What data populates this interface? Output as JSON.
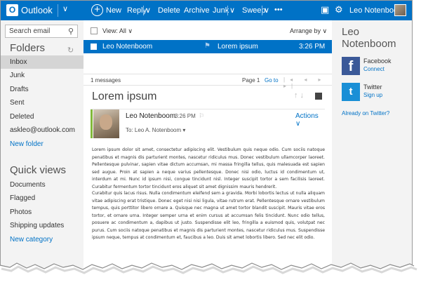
{
  "topbar": {
    "logo_letter": "O",
    "brand": "Outlook",
    "brand_chevron": "∨",
    "new_label": "New",
    "new_icon": "+",
    "reply_label": "Reply",
    "reply_chevron": "∨",
    "delete_label": "Delete",
    "archive_label": "Archive",
    "junk_label": "Junk",
    "junk_chevron": "∨",
    "sweep_label": "Sweep",
    "sweep_chevron": "∨",
    "more_label": "•••",
    "chat_icon": "▣",
    "gear_icon": "⚙",
    "user_name": "Leo Notenboom",
    "color": "#0072c6"
  },
  "leftnav": {
    "search_placeholder": "Search email",
    "search_icon": "⚲",
    "folders_heading": "Folders",
    "refresh_icon": "↻",
    "folders": [
      "Inbox",
      "Junk",
      "Drafts",
      "Sent",
      "Deleted",
      "askleo@outlook.com"
    ],
    "new_folder": "New folder",
    "quick_views_heading": "Quick views",
    "quick_views": [
      "Documents",
      "Flagged",
      "Photos",
      "Shipping updates"
    ],
    "new_category": "New category"
  },
  "list": {
    "view_label": "View: All",
    "view_chevron": "∨",
    "arrange_label": "Arrange by",
    "arrange_chevron": "∨",
    "message": {
      "from": "Leo Notenboom",
      "flag_icon": "⚑",
      "subject": "Lorem ipsum",
      "time": "3:26 PM"
    },
    "count": "1 messages",
    "page": "Page 1",
    "goto": "Go to",
    "arrows": "|◂ ◂ ▸ ▸|"
  },
  "reading": {
    "title": "Lorem ipsum",
    "tools": "↑ ↓",
    "sender": "Leo Notenboom",
    "time": "3:26 PM",
    "flag_icon": "⚐",
    "to": "To: Leo A. Notenboom ▾",
    "actions": "Actions ∨",
    "paragraph1": "Lorem ipsum dolor sit amet, consectetur adipiscing elit. Vestibulum quis neque odio. Cum sociis natoque penatibus et magnis dis parturient montes, nascetur ridiculus mus. Donec vestibulum ullamcorper laoreet. Pellentesque pulvinar, sapien vitae dictum accumsan, mi massa fringilla tellus, quis malesuada est sapien sed augue. Proin at sapien a neque varius pellentesque. Donec nisi odio, luctus id condimentum ut, interdum at mi. Nunc id ipsum nisi, congue tincidunt nisl. Integer suscipit tortor a sem facilisis laoreet. Curabitur fermentum tortor tincidunt eros aliquet sit amet dignissim mauris hendrerit.",
    "paragraph2": "Curabitur quis lacus risus. Nulla condimentum eleifend sem a gravida. Morbi lobortis lectus ut nulla aliquam vitae adipiscing erat tristique. Donec eget nisi nisi ligula, vitae rutrum erat. Pellentesque ornare vestibulum tempus, quis porttitor libero ornare a. Quisque nec magna ut amet tortor blandit suscipit. Mauris vitae eros tortor, et ornare urna. Integer semper urna et enim cursus at accumsan felis tincidunt. Nunc odio tellus, posuere ac condimentum a, dapibus ut justo. Suspendisse elit leo, fringilla a euismod quis, volutpat nec purus. Cum sociis natoque penatibus et magnis dis parturient montes, nascetur ridiculus mus. Suspendisse ipsum neque, tempus at condimentum et, faucibus a leo. Duis sit amet lobortis libero. Sed nec elit odio."
  },
  "right": {
    "user_first": "Leo",
    "user_last": "Notenboom",
    "facebook": {
      "icon": "f",
      "name": "Facebook",
      "action": "Connect",
      "color": "#3b5998"
    },
    "twitter": {
      "icon": "t",
      "name": "Twitter",
      "action": "Sign up",
      "color": "#1a8fd6"
    },
    "already": "Already on Twitter?"
  }
}
